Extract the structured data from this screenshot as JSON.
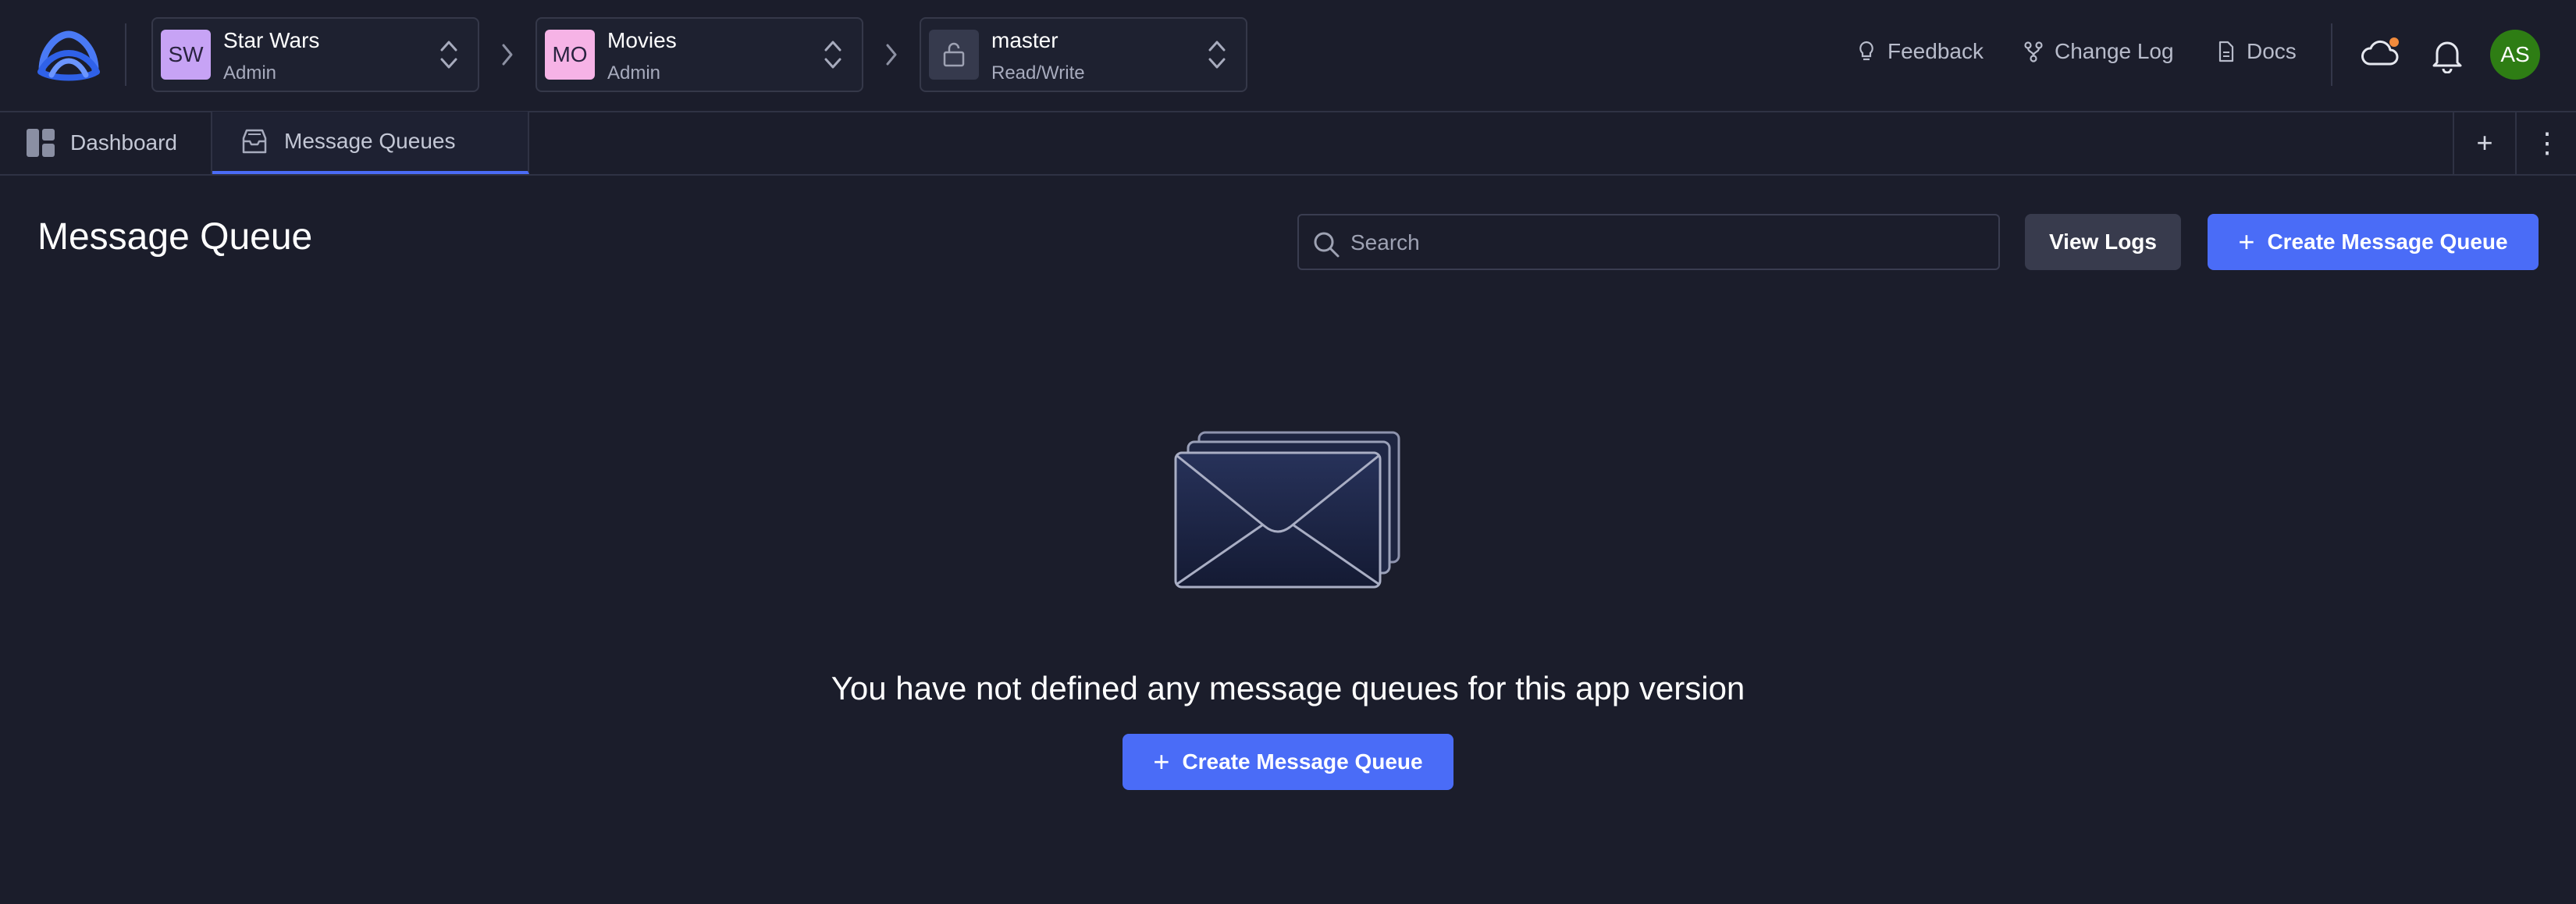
{
  "topbar": {
    "logo": "company-logo",
    "selectors": [
      {
        "badge": "SW",
        "title": "Star Wars",
        "subtitle": "Admin",
        "badge_color": "#c7a3f5"
      },
      {
        "badge": "MO",
        "title": "Movies",
        "subtitle": "Admin",
        "badge_color": "#f6b3e6"
      },
      {
        "badge_icon": "lock-icon",
        "title": "master",
        "subtitle": "Read/Write"
      }
    ],
    "links": [
      {
        "label": "Feedback",
        "icon": "lightbulb-icon"
      },
      {
        "label": "Change Log",
        "icon": "git-branch-icon"
      },
      {
        "label": "Docs",
        "icon": "document-icon"
      }
    ],
    "cloud_icon": "cloud-icon",
    "bell_icon": "bell-icon",
    "avatar": "AS",
    "avatar_color": "#2e7d14",
    "notification_dot_color": "#f08a3c"
  },
  "tabs": [
    {
      "label": "Dashboard",
      "icon": "dashboard-icon",
      "active": false
    },
    {
      "label": "Message Queues",
      "icon": "inbox-icon",
      "active": true
    }
  ],
  "tab_actions": {
    "add": "+",
    "more": "⋮"
  },
  "main": {
    "title": "Message Queue",
    "search_placeholder": "Search",
    "view_logs_label": "View Logs",
    "create_label": "Create Message Queue",
    "empty_message": "You have not defined any message queues for this app version",
    "empty_create_label": "Create Message Queue"
  },
  "colors": {
    "background": "#1b1d2b",
    "accent": "#4a6cf7",
    "button_gray": "#383b4d"
  }
}
